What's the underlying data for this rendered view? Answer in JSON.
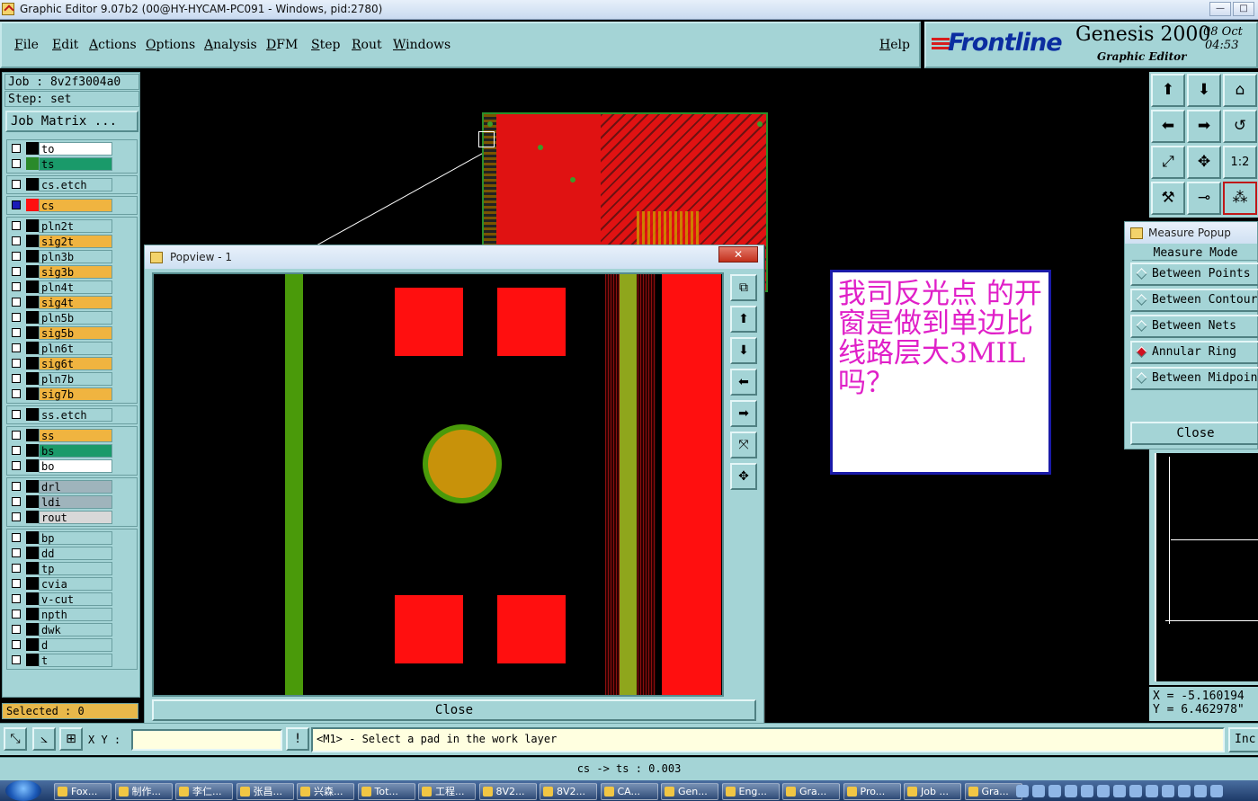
{
  "window": {
    "title": "Graphic Editor 9.07b2 (00@HY-HYCAM-PC091 - Windows, pid:2780)",
    "minimize": "—",
    "maximize": "□"
  },
  "menu": {
    "items": [
      "File",
      "Edit",
      "Actions",
      "Options",
      "Analysis",
      "DFM",
      "Step",
      "Rout",
      "Windows"
    ],
    "help": "Help"
  },
  "brand": {
    "logo": "Frontline",
    "product": "Genesis 2000",
    "subtitle": "Graphic Editor",
    "date": "08 Oct",
    "time": "04:53"
  },
  "job": {
    "job_label": "Job : 8v2f3004a0",
    "step_label": "Step: set",
    "matrix_button": "Job Matrix ..."
  },
  "layer_groups": [
    [
      {
        "name": "to",
        "color": "#ffffff",
        "swatch": "#000000"
      },
      {
        "name": "ts",
        "color": "#1a9a6a",
        "swatch": "#2a8a2a"
      }
    ],
    [
      {
        "name": "cs.etch",
        "color": "#a4d4d6",
        "swatch": "#000000"
      }
    ],
    [
      {
        "name": "cs",
        "color": "#f0b440",
        "swatch": "#ff1010",
        "work": true
      }
    ],
    [
      {
        "name": "pln2t",
        "color": "#a4d4d6",
        "swatch": "#000000"
      },
      {
        "name": "sig2t",
        "color": "#f0b440",
        "swatch": "#000000"
      },
      {
        "name": "pln3b",
        "color": "#a4d4d6",
        "swatch": "#000000"
      },
      {
        "name": "sig3b",
        "color": "#f0b440",
        "swatch": "#000000"
      },
      {
        "name": "pln4t",
        "color": "#a4d4d6",
        "swatch": "#000000"
      },
      {
        "name": "sig4t",
        "color": "#f0b440",
        "swatch": "#000000"
      },
      {
        "name": "pln5b",
        "color": "#a4d4d6",
        "swatch": "#000000"
      },
      {
        "name": "sig5b",
        "color": "#f0b440",
        "swatch": "#000000"
      },
      {
        "name": "pln6t",
        "color": "#a4d4d6",
        "swatch": "#000000"
      },
      {
        "name": "sig6t",
        "color": "#f0b440",
        "swatch": "#000000"
      },
      {
        "name": "pln7b",
        "color": "#a4d4d6",
        "swatch": "#000000"
      },
      {
        "name": "sig7b",
        "color": "#f0b440",
        "swatch": "#000000"
      }
    ],
    [
      {
        "name": "ss.etch",
        "color": "#a4d4d6",
        "swatch": "#000000"
      }
    ],
    [
      {
        "name": "ss",
        "color": "#f0b440",
        "swatch": "#000000"
      },
      {
        "name": "bs",
        "color": "#1a9a6a",
        "swatch": "#000000"
      },
      {
        "name": "bo",
        "color": "#ffffff",
        "swatch": "#000000"
      }
    ],
    [
      {
        "name": "drl",
        "color": "#9fb4bc",
        "swatch": "#000000"
      },
      {
        "name": "ldi",
        "color": "#9fb4bc",
        "swatch": "#000000"
      },
      {
        "name": "rout",
        "color": "#d8d8d8",
        "swatch": "#000000"
      }
    ],
    [
      {
        "name": "bp",
        "color": "#a4d4d6",
        "swatch": "#000000"
      },
      {
        "name": "dd",
        "color": "#a4d4d6",
        "swatch": "#000000"
      },
      {
        "name": "tp",
        "color": "#a4d4d6",
        "swatch": "#000000"
      },
      {
        "name": "cvia",
        "color": "#a4d4d6",
        "swatch": "#000000"
      },
      {
        "name": "v-cut",
        "color": "#a4d4d6",
        "swatch": "#000000"
      },
      {
        "name": "npth",
        "color": "#a4d4d6",
        "swatch": "#000000"
      },
      {
        "name": "dwk",
        "color": "#a4d4d6",
        "swatch": "#000000"
      },
      {
        "name": "d",
        "color": "#a4d4d6",
        "swatch": "#000000"
      },
      {
        "name": "t",
        "color": "#a4d4d6",
        "swatch": "#000000"
      }
    ]
  ],
  "selected": "Selected : 0",
  "popview": {
    "title": "Popview - 1",
    "close_label": "Close"
  },
  "note": {
    "text": "我司反光点 的开窗是做到单边比线路层大3MIL吗？"
  },
  "measure": {
    "title": "Measure Popup",
    "mode_label": "Measure Mode",
    "options": [
      {
        "label": "Between Points",
        "selected": false
      },
      {
        "label": "Between Contours",
        "selected": false
      },
      {
        "label": "Between Nets",
        "selected": false
      },
      {
        "label": "Annular Ring",
        "selected": true
      },
      {
        "label": "Between Midpoints",
        "selected": false
      }
    ],
    "close_label": "Close"
  },
  "coords": {
    "x": "X = -5.160194",
    "y": "Y = 6.462978\""
  },
  "bottom": {
    "xy_label": "X Y :",
    "xy_value": "",
    "prompt": "<M1> - Select a pad in the work layer",
    "inc_label": "Inc",
    "status": "cs -> ts : 0.003"
  },
  "taskbar": {
    "items": [
      "Fox...",
      "制作...",
      "李仁...",
      "张昌...",
      "兴森...",
      "Tot...",
      "工程...",
      "8V2...",
      "8V2...",
      "CA...",
      "Gen...",
      "Eng...",
      "Gra...",
      "Pro...",
      "Job ...",
      "Gra..."
    ]
  }
}
